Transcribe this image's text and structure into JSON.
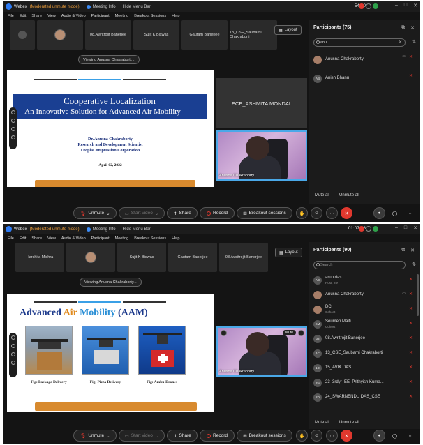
{
  "top": {
    "titlebar": {
      "app": "Webex",
      "mode": "(Moderated unmute mode)",
      "meeting_info": "Meeting Info",
      "hide_menu": "Hide Menu Bar",
      "time": "54:10"
    },
    "menu": [
      "File",
      "Edit",
      "Share",
      "View",
      "Audio & Video",
      "Participant",
      "Meeting",
      "Breakout Sessions",
      "Help"
    ],
    "tiles": [
      "",
      "",
      "08.Awritrojit Banerjee",
      "Sujit K Biswas",
      "Gautam Banerjee",
      "13_CSE_Saubarni Chakraborti"
    ],
    "layout_label": "Layout",
    "viewing_label": "Viewing Anusna Chakraborti...",
    "slide": {
      "title": "Cooperative Localization",
      "subtitle": "An Innovative Solution for Advanced Air Mobility",
      "author_lines": [
        "Dr. Anusna Chakraborty",
        "Research and Development Scientist",
        "UtopiaCompression Corporation"
      ],
      "date": "April 02, 2022"
    },
    "name_tile": "ECE_ASHMITA MONDAL",
    "video_label": "Anusna Chakraborty",
    "participants": {
      "header": "Participants (75)",
      "search_value": "anu",
      "list": [
        {
          "initials": "",
          "name": "Anusna Chakraborty",
          "role": ""
        },
        {
          "initials": "AB",
          "name": "Anish Bhanu",
          "role": ""
        }
      ],
      "mute_all": "Mute all",
      "unmute_all": "Unmute all"
    },
    "controls": {
      "unmute": "Unmute",
      "start_video": "Start video",
      "share": "Share",
      "record": "Record",
      "breakout": "Breakout sessions"
    }
  },
  "bottom": {
    "titlebar": {
      "app": "Webex",
      "mode": "(Moderated unmute mode)",
      "meeting_info": "Meeting Info",
      "hide_menu": "Hide Menu Bar",
      "time": "01:07:48"
    },
    "menu": [
      "File",
      "Edit",
      "Share",
      "View",
      "Audio & Video",
      "Participant",
      "Meeting",
      "Breakout Sessions",
      "Help"
    ],
    "tiles": [
      "Harshita Mishra",
      "",
      "Sujit K Biswas",
      "Gautam Banerjee",
      "08.Awritrojit Banerjee"
    ],
    "layout_label": "Layout",
    "viewing_label": "Viewing Anusna Chakraborty...",
    "slide": {
      "title_a": "Advanced ",
      "title_b": "Air",
      "title_c": " Mobility",
      "title_d": " (AAM)",
      "captions": [
        "Fig: Package Delivery",
        "Fig: Pizza Delivery",
        "Fig: Ambu-Drones"
      ]
    },
    "video_label": "Anusna Chakraborty",
    "mute_chip": "Mute",
    "participants": {
      "header": "Participants (90)",
      "search_placeholder": "Search",
      "list": [
        {
          "initials": "AD",
          "name": "arup das",
          "role": "Host, me"
        },
        {
          "initials": "",
          "name": "Anusna Chakraborty",
          "role": ""
        },
        {
          "initials": "",
          "name": "DC",
          "role": "Cohost"
        },
        {
          "initials": "SM",
          "name": "Soumen Maiti",
          "role": "Cohost"
        },
        {
          "initials": "08",
          "name": "08.Awritrojit Banerjee",
          "role": ""
        },
        {
          "initials": "1C",
          "name": "13_CSE_Saubarni Chakraborti",
          "role": ""
        },
        {
          "initials": "1D",
          "name": "15_AVIK DAS",
          "role": ""
        },
        {
          "initials": "2G",
          "name": "23_3rdyr_EE_Prithyish Kuma...",
          "role": ""
        },
        {
          "initials": "2D",
          "name": "24_SWARNENDU DAS_CSE",
          "role": ""
        }
      ],
      "mute_all": "Mute all",
      "unmute_all": "Unmute all"
    },
    "controls": {
      "unmute": "Unmute",
      "start_video": "Start video",
      "share": "Share",
      "record": "Record",
      "breakout": "Breakout sessions"
    }
  }
}
